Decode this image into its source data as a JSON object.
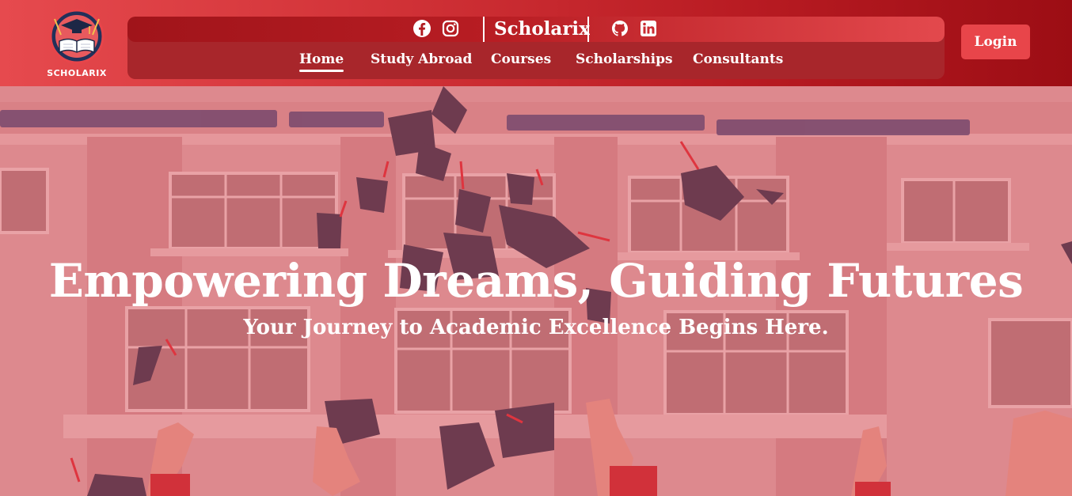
{
  "brand": {
    "logo_text": "SCHOLARIX",
    "name": "Scholarix"
  },
  "social": {
    "left_icons": [
      "facebook-icon",
      "instagram-icon"
    ],
    "right_icons": [
      "github-icon",
      "linkedin-icon"
    ]
  },
  "nav": {
    "items": [
      {
        "label": "Home",
        "active": true
      },
      {
        "label": "Study Abroad",
        "active": false
      },
      {
        "label": "Courses",
        "active": false
      },
      {
        "label": "Scholarships",
        "active": false
      },
      {
        "label": "Consultants",
        "active": false
      }
    ]
  },
  "header": {
    "login_label": "Login"
  },
  "hero": {
    "title": "Empowering Dreams, Guiding Futures",
    "subtitle": "Your Journey to Academic Excellence Begins Here."
  },
  "colors": {
    "header_gradient_start": "#e64a4e",
    "header_gradient_end": "#9c0d14",
    "login_button": "#e8454a",
    "nav_pill": "#a8262b",
    "text": "#ffffff"
  }
}
